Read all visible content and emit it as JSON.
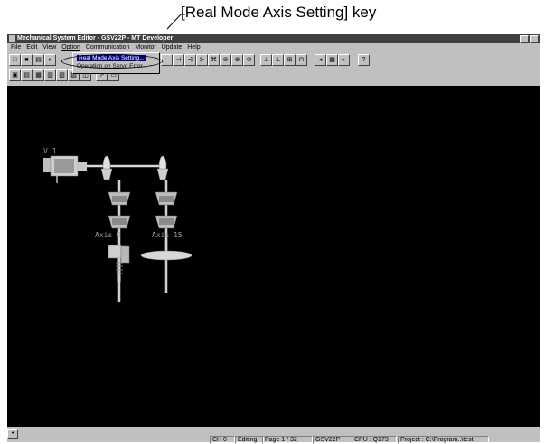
{
  "callout": {
    "text": "[Real Mode Axis Setting] key"
  },
  "window": {
    "title": "Mechanical System Editor - GSV22P - MT Developer"
  },
  "menubar": {
    "items": [
      "File",
      "Edit",
      "View",
      "Option",
      "Communication",
      "Monitor",
      "Update",
      "Help"
    ]
  },
  "dropdown": {
    "items": [
      "Real Mode Axis Setting...",
      "Operation on Servo Error..."
    ]
  },
  "canvas": {
    "drive_label": "V.1",
    "axis_label_left": "Axis 6",
    "axis_label_right": "Axis 15"
  },
  "statusbar": {
    "ch": "CH 0",
    "mode": "Editing",
    "page": "Page 1 / 32",
    "system": "GSV22P",
    "cpu": "CPU : Q173",
    "project": "Project : C:\\Program..\\test"
  },
  "colors": {
    "canvas_bg": "#000000",
    "menu_highlight": "#000080",
    "chrome": "#c0c0c0"
  }
}
